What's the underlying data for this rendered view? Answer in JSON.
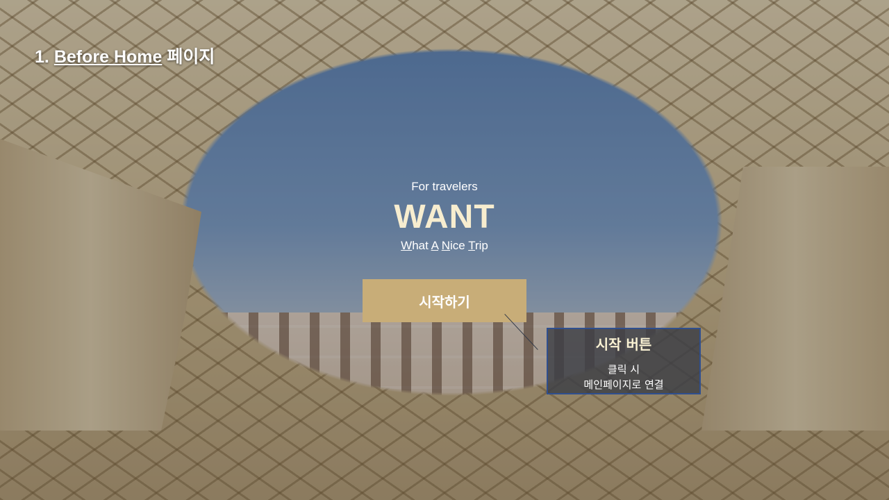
{
  "slide": {
    "number": "1.",
    "title_underlined": "Before Home",
    "title_suffix": "페이지"
  },
  "hero": {
    "tagline": "For travelers",
    "brand": "WANT",
    "subtitle": {
      "w": "W",
      "w_rest": "hat ",
      "a": "A",
      "a_rest": " ",
      "n": "N",
      "n_rest": "ice ",
      "t": "T",
      "t_rest": "rip"
    }
  },
  "start_button": {
    "label": "시작하기"
  },
  "annotation": {
    "title": "시작 버튼",
    "line1": "클릭 시",
    "line2": "메인페이지로 연결"
  }
}
